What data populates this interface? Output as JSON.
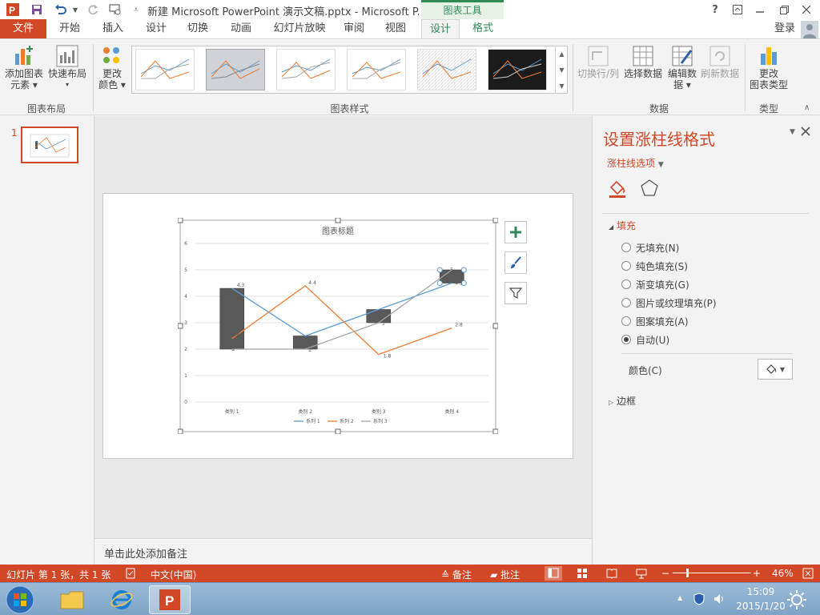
{
  "window": {
    "title": "新建 Microsoft PowerPoint 演示文稿.pptx - Microsoft P...",
    "context_tools_label": "图表工具",
    "help_label": "?",
    "sign_in": "登录"
  },
  "tabs": [
    "文件",
    "开始",
    "插入",
    "设计",
    "切换",
    "动画",
    "幻灯片放映",
    "审阅",
    "视图",
    "设计",
    "格式"
  ],
  "ribbon": {
    "add_element_line1": "添加图表",
    "add_element_line2": "元素",
    "quick_layout": "快速布局",
    "change_colors_line1": "更改",
    "change_colors_line2": "颜色",
    "group_layout": "图表布局",
    "group_styles": "图表样式",
    "switch_row_col": "切换行/列",
    "select_data": "选择数据",
    "edit_data_line1": "编辑数",
    "edit_data_line2": "据",
    "refresh_data": "刷新数据",
    "group_data": "数据",
    "change_type_line1": "更改",
    "change_type_line2": "图表类型",
    "group_type": "类型"
  },
  "slides_pane": {
    "slide_number": "1"
  },
  "chart": {
    "title": "图表标题"
  },
  "chart_data": {
    "type": "line",
    "title": "图表标题",
    "categories": [
      "类别 1",
      "类别 2",
      "类别 3",
      "类别 4"
    ],
    "ylim": [
      0,
      6
    ],
    "yticks": [
      "0",
      "1",
      "2",
      "3",
      "4",
      "5",
      "6"
    ],
    "series": [
      {
        "name": "系列 1",
        "values": [
          4.3,
          2.5,
          3.5,
          4.5
        ],
        "color": "#5b9bd5"
      },
      {
        "name": "系列 2",
        "values": [
          2.4,
          4.4,
          1.8,
          2.8
        ],
        "color": "#ed7d31"
      },
      {
        "name": "系列 3",
        "values": [
          2,
          2,
          3,
          5
        ],
        "color": "#a5a5a5"
      }
    ],
    "value_labels": [
      "4.3",
      "2.4",
      "2",
      "4.4",
      "2",
      "3",
      "1.8",
      "5",
      "4.5",
      "2.8"
    ],
    "up_down_bars": true,
    "grid": true,
    "legend": "bottom"
  },
  "notes": {
    "placeholder": "单击此处添加备注"
  },
  "format_pane": {
    "title": "设置涨柱线格式",
    "options_label": "涨柱线选项",
    "section_fill": "填充",
    "options": [
      "无填充(N)",
      "纯色填充(S)",
      "渐变填充(G)",
      "图片或纹理填充(P)",
      "图案填充(A)",
      "自动(U)"
    ],
    "selected_option_index": 5,
    "color_label": "颜色(C)",
    "section_border": "边框"
  },
  "statusbar": {
    "slide_info": "幻灯片 第 1 张，共 1 张",
    "language": "中文(中国)",
    "notes": "备注",
    "comments": "批注",
    "zoom": "46%"
  },
  "taskbar": {
    "time": "15:09",
    "date": "2015/1/20"
  }
}
